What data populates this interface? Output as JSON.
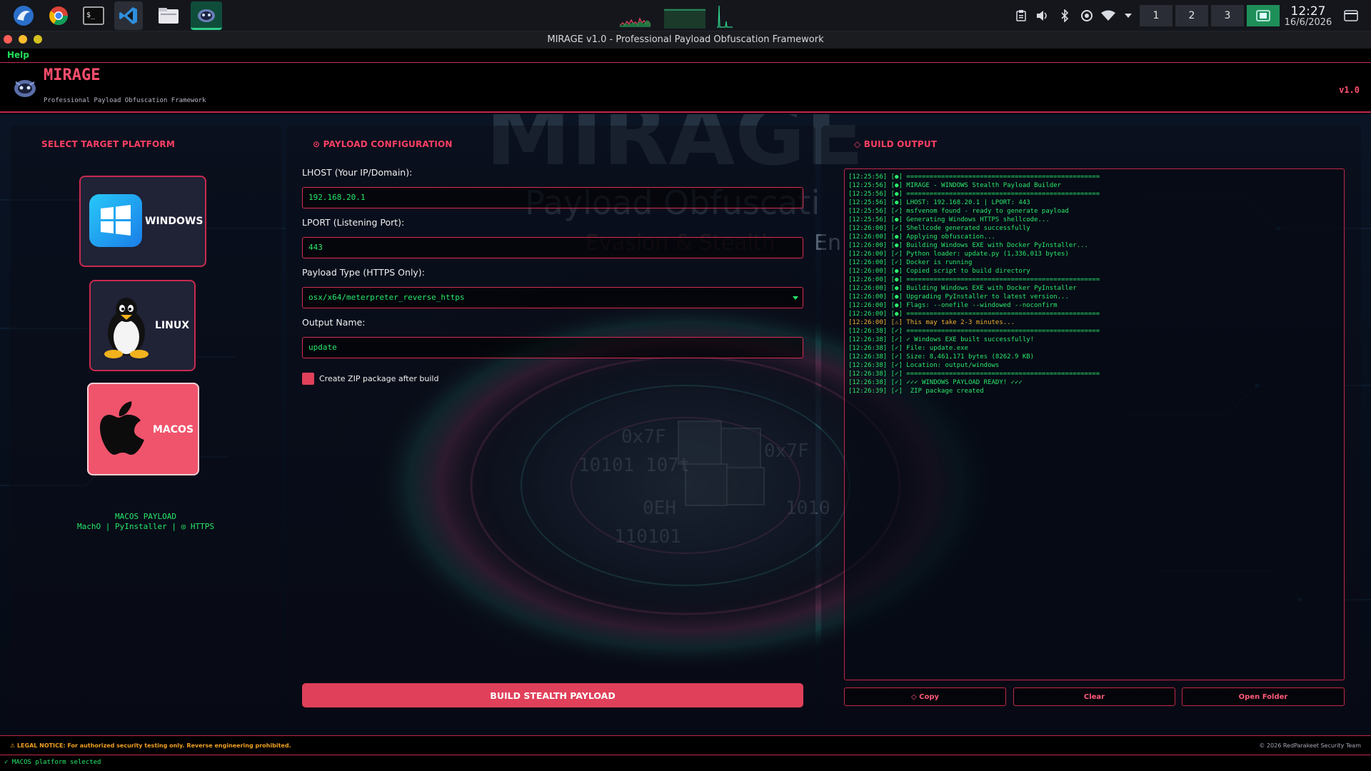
{
  "taskbar": {
    "apps": [
      {
        "name": "kali-menu-icon",
        "active": false
      },
      {
        "name": "chrome-icon",
        "active": false
      },
      {
        "name": "terminal-icon",
        "active": false
      },
      {
        "name": "vscode-icon",
        "active": false
      },
      {
        "name": "file-manager-icon",
        "active": false
      },
      {
        "name": "mirage-app-icon",
        "active": true
      }
    ],
    "tray_icons": [
      "clipboard-icon",
      "volume-icon",
      "bluetooth-icon",
      "settings-icon",
      "wifi-icon",
      "chevron-down-icon"
    ],
    "workspaces": [
      "1",
      "2",
      "3"
    ],
    "active_workspace_icon": "workspace-app-icon",
    "clock_time": "12:27",
    "clock_date": "16/6/2026"
  },
  "window": {
    "title": "MIRAGE v1.0 - Professional Payload Obfuscation Framework"
  },
  "menu": {
    "help": "Help"
  },
  "header": {
    "app_name": "MIRAGE",
    "tagline": "Professional Payload Obfuscation Framework",
    "version": "v1.0"
  },
  "background_text": {
    "big_title": "MIRAGE",
    "subtitle": "Payload Obfuscati",
    "line3": "Evasion & Stealth",
    "line3b": "En"
  },
  "platform_panel": {
    "title": "SELECT TARGET PLATFORM",
    "platforms": [
      {
        "id": "windows",
        "label": "WINDOWS",
        "selected": false
      },
      {
        "id": "linux",
        "label": "LINUX",
        "selected": false
      },
      {
        "id": "macos",
        "label": "MACOS",
        "selected": true
      }
    ],
    "info_line1": " MACOS PAYLOAD",
    "info_line2": " MachO |  PyInstaller | ◎ HTTPS"
  },
  "config_panel": {
    "title": "⊙ PAYLOAD CONFIGURATION",
    "lhost_label": "LHOST (Your IP/Domain):",
    "lhost_value": "192.168.20.1",
    "lport_label": "LPORT (Listening Port):",
    "lport_value": "443",
    "payload_label": "Payload Type (HTTPS Only):",
    "payload_value": "osx/x64/meterpreter_reverse_https",
    "output_label": "Output Name:",
    "output_value": "update",
    "zip_label": "Create ZIP package after build",
    "zip_checked": true,
    "build_button": "BUILD STEALTH PAYLOAD"
  },
  "output_panel": {
    "title": "◇ BUILD OUTPUT",
    "log": [
      {
        "text": "[12:25:56] [●] ==================================================",
        "level": "info"
      },
      {
        "text": "[12:25:56] [●] MIRAGE - WINDOWS Stealth Payload Builder",
        "level": "info"
      },
      {
        "text": "[12:25:56] [●] ==================================================",
        "level": "info"
      },
      {
        "text": "[12:25:56] [●] LHOST: 192.168.20.1 | LPORT: 443",
        "level": "info"
      },
      {
        "text": "[12:25:56] [✓] msfvenom found - ready to generate payload",
        "level": "info"
      },
      {
        "text": "[12:25:56] [●] Generating Windows HTTPS shellcode...",
        "level": "info"
      },
      {
        "text": "[12:26:00] [✓] Shellcode generated successfully",
        "level": "info"
      },
      {
        "text": "[12:26:00] [●] Applying obfuscation...",
        "level": "info"
      },
      {
        "text": "[12:26:00] [●] Building Windows EXE with Docker PyInstaller...",
        "level": "info"
      },
      {
        "text": "[12:26:00] [✓] Python loader: update.py (1,336,013 bytes)",
        "level": "info"
      },
      {
        "text": "[12:26:00] [✓] Docker is running",
        "level": "info"
      },
      {
        "text": "[12:26:00] [●] Copied script to build directory",
        "level": "info"
      },
      {
        "text": "[12:26:00] [●] ==================================================",
        "level": "info"
      },
      {
        "text": "[12:26:00] [●] Building Windows EXE with Docker PyInstaller",
        "level": "info"
      },
      {
        "text": "[12:26:00] [●] Upgrading PyInstaller to latest version...",
        "level": "info"
      },
      {
        "text": "[12:26:00] [●] Flags: --onefile --windowed --noconfirm",
        "level": "info"
      },
      {
        "text": "[12:26:00] [●] ==================================================",
        "level": "info"
      },
      {
        "text": "[12:26:00] [⚠] This may take 2-3 minutes...",
        "level": "warn"
      },
      {
        "text": "[12:26:38] [✓] ==================================================",
        "level": "info"
      },
      {
        "text": "[12:26:38] [✓] ✓ Windows EXE built successfully!",
        "level": "info"
      },
      {
        "text": "[12:26:38] [✓] File: update.exe",
        "level": "info"
      },
      {
        "text": "[12:26:38] [✓] Size: 8,461,171 bytes (8262.9 KB)",
        "level": "info"
      },
      {
        "text": "[12:26:38] [✓] Location: output/windows",
        "level": "info"
      },
      {
        "text": "[12:26:38] [✓] ==================================================",
        "level": "info"
      },
      {
        "text": "[12:26:38] [✓] ✓✓✓ WINDOWS PAYLOAD READY! ✓✓✓",
        "level": "info"
      },
      {
        "text": "[12:26:39] [✓]  ZIP package created",
        "level": "info"
      }
    ],
    "copy_button": "◇ Copy",
    "clear_button": " Clear",
    "open_folder_button": "Open Folder"
  },
  "footer": {
    "legal": "⚠ LEGAL NOTICE: For authorized security testing only. Reverse engineering prohibited.",
    "copyright": "© 2026 RedParakeet Security Team"
  },
  "status": {
    "text": "✓ MACOS platform selected"
  },
  "colors": {
    "accent": "#e0405a",
    "accent_text": "#ff3f64",
    "log_green": "#2ce86a",
    "warn": "#f0b030",
    "header_bg": "#000000"
  }
}
